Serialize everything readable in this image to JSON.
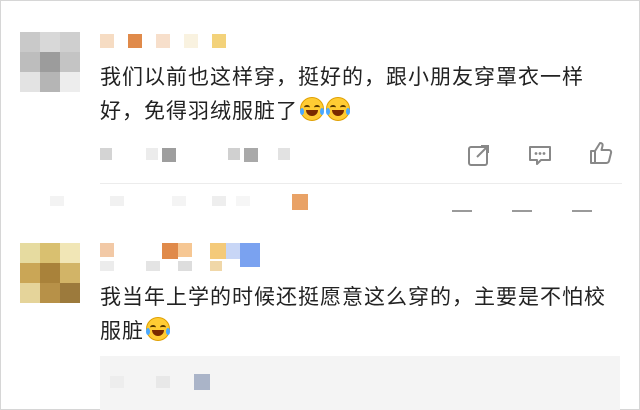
{
  "comments": [
    {
      "text": "我们以前也这样穿，挺好的，跟小朋友穿罩衣一样好，免得羽绒服脏了",
      "emoji": [
        "crying-laughing-emoji",
        "crying-laughing-emoji"
      ]
    },
    {
      "text": "我当年上学的时候还挺愿意这么穿的，主要是不怕校服脏",
      "emoji": [
        "crying-laughing-emoji"
      ]
    }
  ],
  "actions": [
    "share-icon",
    "comment-icon",
    "like-icon"
  ],
  "colors": {
    "text": "#222222",
    "icon": "#888888",
    "emoji_face": "#ffcc33",
    "reply_bg": "#f4f4f4"
  }
}
